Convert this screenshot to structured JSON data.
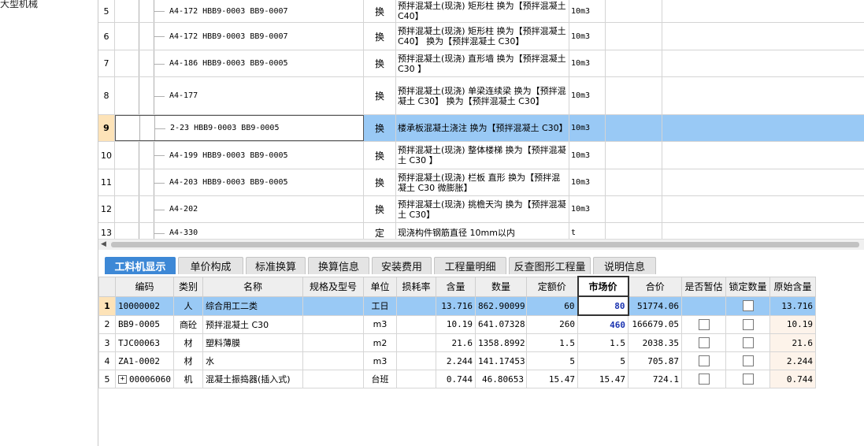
{
  "sidebar": {
    "item": "大型机械"
  },
  "top_rows": [
    {
      "num": "5",
      "code": "A4-172 HBB9-0003 BB9-0007",
      "type": "换",
      "name": "预拌混凝土(现浇) 矩形柱  换为【预拌混凝土 C40】",
      "unit": "10m3"
    },
    {
      "num": "6",
      "code": "A4-172 HBB9-0003 BB9-0007",
      "type": "换",
      "name": "预拌混凝土(现浇) 矩形柱  换为【预拌混凝土 C40】  换为【预拌混凝土 C30】",
      "unit": "10m3"
    },
    {
      "num": "7",
      "code": "A4-186 HBB9-0003 BB9-0005",
      "type": "换",
      "name": "预拌混凝土(现浇) 直形墙  换为【预拌混凝土 C30 】",
      "unit": "10m3"
    },
    {
      "num": "8",
      "code": "A4-177",
      "type": "换",
      "name": "预拌混凝土(现浇) 单梁连续梁  换为【预拌混凝土 C30】  换为【预拌混凝土 C30】",
      "unit": "10m3"
    },
    {
      "num": "9",
      "code": "2-23 HBB9-0003 BB9-0005",
      "type": "换",
      "name": "楼承板混凝土浇注  换为【预拌混凝土 C30】",
      "unit": "10m3"
    },
    {
      "num": "10",
      "code": "A4-199 HBB9-0003 BB9-0005",
      "type": "换",
      "name": "预拌混凝土(现浇) 整体楼梯  换为【预拌混凝土 C30 】",
      "unit": "10m3"
    },
    {
      "num": "11",
      "code": "A4-203 HBB9-0003 BB9-0005",
      "type": "换",
      "name": "预拌混凝土(现浇) 栏板 直形  换为【预拌混凝土 C30 微膨胀】",
      "unit": "10m3"
    },
    {
      "num": "12",
      "code": "A4-202",
      "type": "换",
      "name": "预拌混凝土(现浇) 挑檐天沟  换为【预拌混凝土 C30】",
      "unit": "10m3"
    },
    {
      "num": "13",
      "code": "A4-330",
      "type": "定",
      "name": "现浇构件钢筋直径 10mm以内",
      "unit": "t"
    }
  ],
  "tabs": [
    "工料机显示",
    "单价构成",
    "标准换算",
    "换算信息",
    "安装费用",
    "工程量明细",
    "反查图形工程量",
    "说明信息"
  ],
  "columns": [
    "编码",
    "类别",
    "名称",
    "规格及型号",
    "单位",
    "损耗率",
    "含量",
    "数量",
    "定额价",
    "市场价",
    "合价",
    "是否暂估",
    "锁定数量",
    "原始含量"
  ],
  "rows": [
    {
      "n": "1",
      "code": "10000002",
      "cat": "人",
      "name": "综合用工二类",
      "spec": "",
      "unit": "工日",
      "loss": "",
      "qty": "13.716",
      "amount": "862.90099",
      "price": "60",
      "market": "80",
      "total": "51774.06",
      "est": false,
      "lock": true,
      "orig": "13.716"
    },
    {
      "n": "2",
      "code": "BB9-0005",
      "cat": "商砼",
      "name": "预拌混凝土 C30",
      "spec": "",
      "unit": "m3",
      "loss": "",
      "qty": "10.19",
      "amount": "641.07328",
      "price": "260",
      "market": "460",
      "total": "166679.05",
      "est": true,
      "lock": true,
      "orig": "10.19"
    },
    {
      "n": "3",
      "code": "TJC00063",
      "cat": "材",
      "name": "塑料薄膜",
      "spec": "",
      "unit": "m2",
      "loss": "",
      "qty": "21.6",
      "amount": "1358.8992",
      "price": "1.5",
      "market": "1.5",
      "total": "2038.35",
      "est": true,
      "lock": true,
      "orig": "21.6"
    },
    {
      "n": "4",
      "code": "ZA1-0002",
      "cat": "材",
      "name": "水",
      "spec": "",
      "unit": "m3",
      "loss": "",
      "qty": "2.244",
      "amount": "141.17453",
      "price": "5",
      "market": "5",
      "total": "705.87",
      "est": true,
      "lock": true,
      "orig": "2.244"
    },
    {
      "n": "5",
      "code": "00006060",
      "cat": "机",
      "name": "混凝土振捣器(插入式)",
      "spec": "",
      "unit": "台班",
      "loss": "",
      "qty": "0.744",
      "amount": "46.80653",
      "price": "15.47",
      "market": "15.47",
      "total": "724.1",
      "est": true,
      "lock": true,
      "orig": "0.744",
      "expand": "+"
    }
  ],
  "scroll_arrow": "◀"
}
